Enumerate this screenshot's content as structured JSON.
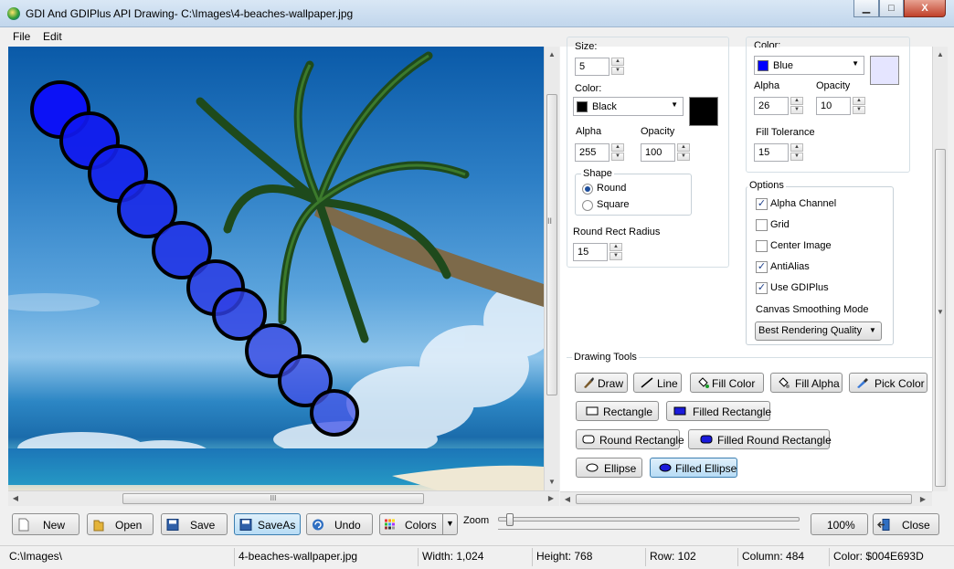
{
  "window": {
    "title": "GDI And GDIPlus API Drawing- C:\\Images\\4-beaches-wallpaper.jpg",
    "min": "▁",
    "max": "□",
    "close": "X"
  },
  "menu": [
    "File",
    "Edit"
  ],
  "pen": {
    "size_label": "Size:",
    "size": "5",
    "color_label": "Color:",
    "color": "Black",
    "color_hex": "#000000",
    "alpha_label": "Alpha",
    "alpha": "255",
    "opacity_label": "Opacity",
    "opacity": "100",
    "shape_label": "Shape",
    "shape_options": [
      "Round",
      "Square"
    ],
    "shape_selected": "Round",
    "radius_label": "Round Rect Radius",
    "radius": "15"
  },
  "fill": {
    "color_label": "Color:",
    "color": "Blue",
    "color_hex": "#0000ff",
    "preview_hex": "#e5e5ff",
    "alpha_label": "Alpha",
    "alpha": "26",
    "opacity_label": "Opacity",
    "opacity": "10",
    "tolerance_label": "Fill Tolerance",
    "tolerance": "15"
  },
  "options": {
    "label": "Options",
    "items": [
      {
        "label": "Alpha Channel",
        "checked": true
      },
      {
        "label": "Grid",
        "checked": false
      },
      {
        "label": "Center Image",
        "checked": false
      },
      {
        "label": "AntiAlias",
        "checked": true
      },
      {
        "label": "Use GDIPlus",
        "checked": true
      }
    ],
    "smoothing_label": "Canvas Smoothing Mode",
    "smoothing": "Best Rendering Quality"
  },
  "tools": {
    "label": "Drawing Tools",
    "draw": "Draw",
    "line": "Line",
    "fill_color": "Fill Color",
    "fill_alpha": "Fill Alpha",
    "pick_color": "Pick Color",
    "rectangle": "Rectangle",
    "filled_rectangle": "Filled Rectangle",
    "round_rectangle": "Round Rectangle",
    "filled_round_rectangle": "Filled Round Rectangle",
    "ellipse": "Ellipse",
    "filled_ellipse": "Filled Ellipse",
    "selected": "Filled Ellipse"
  },
  "toolbar": {
    "new": "New",
    "open": "Open",
    "save": "Save",
    "saveas": "SaveAs",
    "undo": "Undo",
    "colors": "Colors",
    "zoom_label": "Zoom",
    "zoom_level": "100%",
    "close": "Close"
  },
  "status": {
    "path": "C:\\Images\\",
    "file": "4-beaches-wallpaper.jpg",
    "width": "Width: 1,024",
    "height": "Height: 768",
    "row": "Row: 102",
    "column": "Column: 484",
    "color": "Color: $004E693D"
  },
  "scroll_grip": "III",
  "splitter": "II",
  "colors": {
    "pen": "#000000",
    "fill": "#0000ff",
    "accent": "#3c7fb1"
  }
}
